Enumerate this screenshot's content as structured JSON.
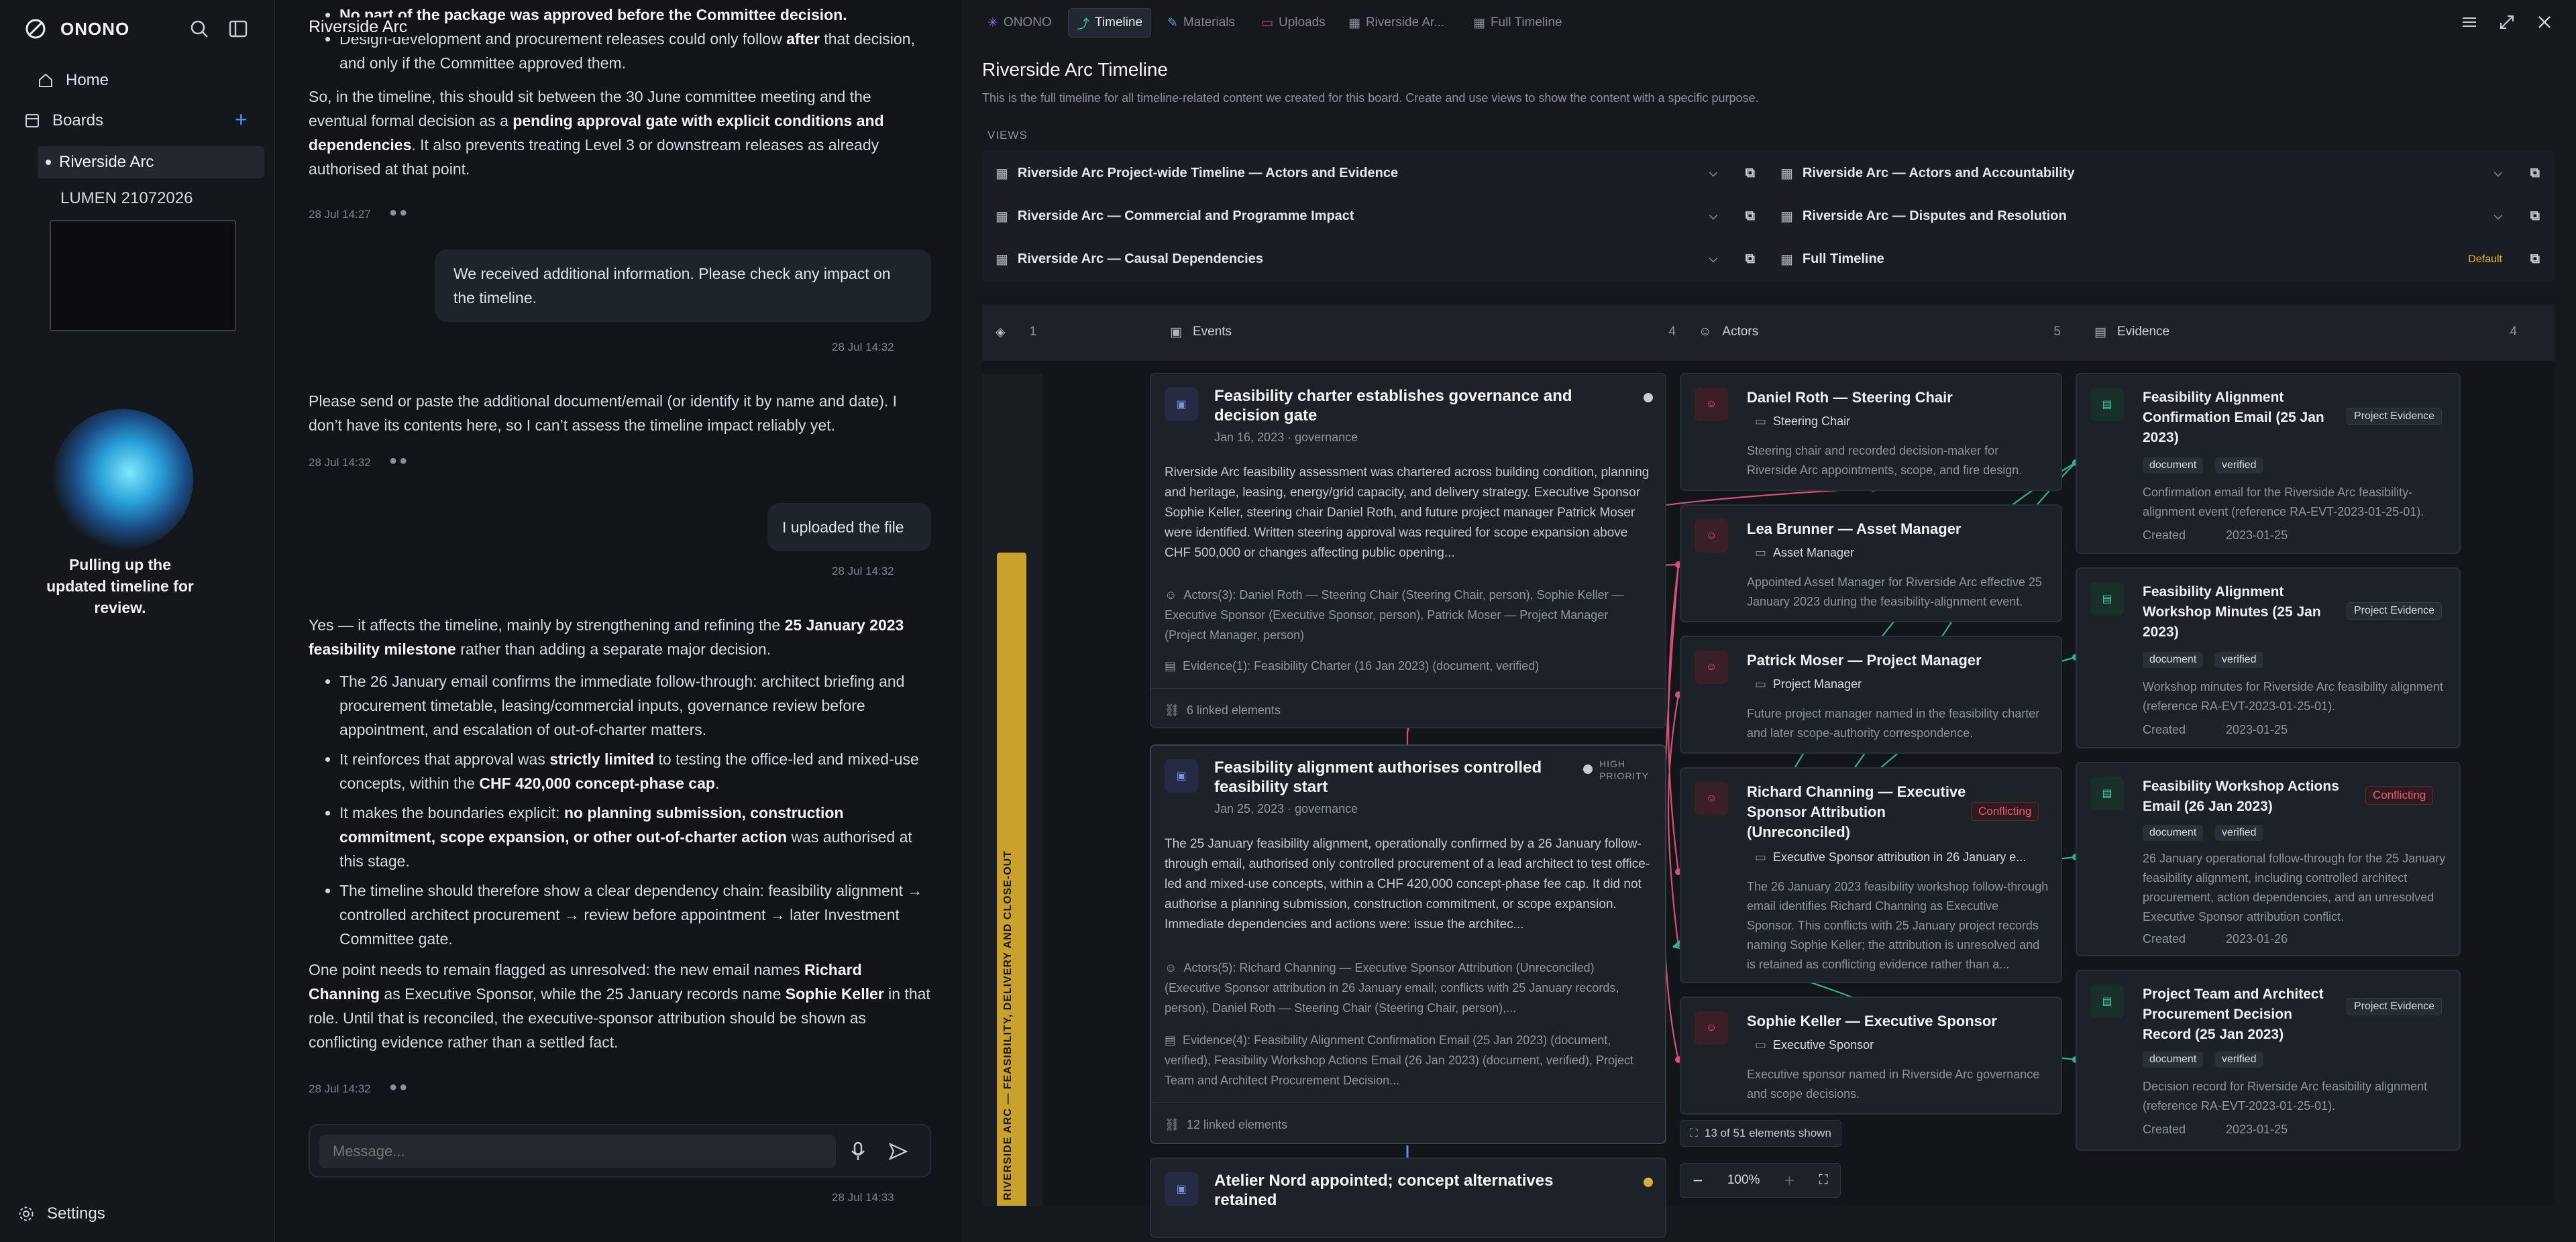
{
  "sidebar": {
    "brand": "ONONO",
    "home": "Home",
    "boards": "Boards",
    "board_items": [
      "Riverside Arc",
      "LUMEN 21072026"
    ],
    "status_text": "Pulling up the updated timeline for review.",
    "settings": "Settings"
  },
  "chat": {
    "title": "Riverside Arc",
    "m1_b1a": "No part of the package was approved before the Committee decision.",
    "m1_b2a": "Design-development and procurement releases could only follow ",
    "m1_b2b": "after",
    "m1_b2c": " that decision, and only if the Committee approved them.",
    "m1_p_a": "So, in the timeline, this should sit between the 30 June committee meeting and the eventual formal decision as a ",
    "m1_p_b": "pending approval gate with explicit conditions and dependencies",
    "m1_p_c": ". It also prevents treating Level 3 or downstream releases as already authorised at that point.",
    "ts1": "28 Jul 14:27",
    "u1": "We received additional information. Please check any impact on the timeline.",
    "ts2": "28 Jul 14:32",
    "m2": "Please send or paste the additional document/email (or identify it by name and date). I don’t have its contents here, so I can’t assess the timeline impact reliably yet.",
    "ts3": "28 Jul 14:32",
    "u2": "I uploaded the file",
    "ts4": "28 Jul 14:32",
    "m3_p_a": "Yes — it affects the timeline, mainly by strengthening and refining the ",
    "m3_p_b": "25 January 2023 feasibility milestone",
    "m3_p_c": " rather than adding a separate major decision.",
    "m3_l1": "The 26 January email confirms the immediate follow-through: architect briefing and procurement timetable, leasing/commercial inputs, governance review before appointment, and escalation of out-of-charter matters.",
    "m3_l2_a": "It reinforces that approval was ",
    "m3_l2_b": "strictly limited",
    "m3_l2_c": " to testing the office-led and mixed-use concepts, within the ",
    "m3_l2_d": "CHF 420,000 concept-phase cap",
    "m3_l2_e": ".",
    "m3_l3_a": "It makes the boundaries explicit: ",
    "m3_l3_b": "no planning submission, construction commitment, scope expansion, or other out-of-charter action",
    "m3_l3_c": " was authorised at this stage.",
    "m3_l4": "The timeline should therefore show a clear dependency chain: feasibility alignment → controlled architect procurement → review before appointment → later Investment Committee gate.",
    "m3_p2_a": "One point needs to remain flagged as unresolved: the new email names ",
    "m3_p2_b": "Richard Channing",
    "m3_p2_c": " as Executive Sponsor, while the 25 January records name ",
    "m3_p2_d": "Sophie Keller",
    "m3_p2_e": " in that role. Until that is reconciled, the executive-sponsor attribution should be shown as conflicting evidence rather than a settled fact.",
    "ts5": "28 Jul 14:32",
    "placeholder": "Message...",
    "ts6": "28 Jul 14:33"
  },
  "tabs": [
    "ONONO",
    "Timeline",
    "Materials",
    "Uploads",
    "Riverside Ar...",
    "Full Timeline"
  ],
  "timeline": {
    "title": "Riverside Arc Timeline",
    "description": "This is the full timeline for all timeline-related content we created for this board. Create and use views to show the content with a specific purpose.",
    "views_label": "VIEWS",
    "views": [
      "Riverside Arc Project-wide Timeline — Actors and Evidence",
      "Riverside Arc — Actors and Accountability",
      "Riverside Arc — Commercial and Programme Impact",
      "Riverside Arc — Disputes and Resolution",
      "Riverside Arc — Causal Dependencies",
      "Full Timeline"
    ],
    "default_label": "Default",
    "phase_count": "1",
    "columns": [
      {
        "name": "Events",
        "count": "4"
      },
      {
        "name": "Actors",
        "count": "5"
      },
      {
        "name": "Evidence",
        "count": "4"
      }
    ],
    "phase_label": "RIVERSIDE ARC — FEASIBILITY, DELIVERY AND CLOSE-OUT",
    "events": [
      {
        "title": "Feasibility charter establishes governance and decision gate",
        "date": "Jan 16, 2023 · governance",
        "body": "Riverside Arc feasibility assessment was chartered across building condition, planning and heritage, leasing, energy/grid capacity, and delivery strategy. Executive Sponsor Sophie Keller, steering chair Daniel Roth, and future project manager Patrick Moser were identified. Written steering approval was required for scope expansion above CHF 500,000 or changes affecting public opening...",
        "actors": "Actors(3): Daniel Roth — Steering Chair (Steering Chair, person), Sophie Keller — Executive Sponsor (Executive Sponsor, person), Patrick Moser — Project Manager (Project Manager, person)",
        "evidence": "Evidence(1): Feasibility Charter (16 Jan 2023) (document, verified)",
        "linked": "6 linked elements"
      },
      {
        "title": "Feasibility alignment authorises controlled feasibility start",
        "date": "Jan 25, 2023 · governance",
        "priority": "HIGH PRIORITY",
        "body": "The 25 January feasibility alignment, operationally confirmed by a 26 January follow-through email, authorised only controlled procurement of a lead architect to test office-led and mixed-use concepts, within a CHF 420,000 concept-phase fee cap. It did not authorise a planning submission, construction commitment, or scope expansion. Immediate dependencies and actions were: issue the architec...",
        "actors": "Actors(5): Richard Channing — Executive Sponsor Attribution (Unreconciled) (Executive Sponsor attribution in 26 January email; conflicts with 25 January records, person), Daniel Roth — Steering Chair (Steering Chair, person),...",
        "evidence": "Evidence(4): Feasibility Alignment Confirmation Email (25 Jan 2023) (document, verified), Feasibility Workshop Actions Email (26 Jan 2023) (document, verified), Project Team and Architect Procurement Decision...",
        "linked": "12 linked elements"
      },
      {
        "title": "Atelier Nord appointed; concept alternatives retained"
      }
    ],
    "actors": [
      {
        "name": "Daniel Roth — Steering Chair",
        "role": "Steering Chair",
        "desc": "Steering chair and recorded decision-maker for Riverside Arc appointments, scope, and fire design."
      },
      {
        "name": "Lea Brunner — Asset Manager",
        "role": "Asset Manager",
        "desc": "Appointed Asset Manager for Riverside Arc effective 25 January 2023 during the feasibility-alignment event."
      },
      {
        "name": "Patrick Moser — Project Manager",
        "role": "Project Manager",
        "desc": "Future project manager named in the feasibility charter and later scope-authority correspondence."
      },
      {
        "name": "Richard Channing — Executive Sponsor Attribution (Unreconciled)",
        "role": "Executive Sponsor attribution in 26 January e...",
        "conflict": "Conflicting",
        "desc": "The 26 January 2023 feasibility workshop follow-through email identifies Richard Channing as Executive Sponsor. This conflicts with 25 January project records naming Sophie Keller; the attribution is unresolved and is retained as conflicting evidence rather than a..."
      },
      {
        "name": "Sophie Keller — Executive Sponsor",
        "role": "Executive Sponsor",
        "desc": "Executive sponsor named in Riverside Arc governance and scope decisions."
      }
    ],
    "evidence": [
      {
        "name": "Feasibility Alignment Confirmation Email (25 Jan 2023)",
        "tag": "Project Evidence",
        "kind": "document",
        "status": "verified",
        "desc": "Confirmation email for the Riverside Arc feasibility-alignment event (reference RA-EVT-2023-01-25-01).",
        "created_label": "Created",
        "created": "2023-01-25"
      },
      {
        "name": "Feasibility Alignment Workshop Minutes (25 Jan 2023)",
        "tag": "Project Evidence",
        "kind": "document",
        "status": "verified",
        "desc": "Workshop minutes for Riverside Arc feasibility alignment (reference RA-EVT-2023-01-25-01).",
        "created_label": "Created",
        "created": "2023-01-25"
      },
      {
        "name": "Feasibility Workshop Actions Email (26 Jan 2023)",
        "tag": "Conflicting",
        "kind": "document",
        "status": "verified",
        "desc": "26 January operational follow-through for the 25 January feasibility alignment, including controlled architect procurement, action dependencies, and an unresolved Executive Sponsor attribution conflict.",
        "created_label": "Created",
        "created": "2023-01-26"
      },
      {
        "name": "Project Team and Architect Procurement Decision Record (25 Jan 2023)",
        "tag": "Project Evidence",
        "kind": "document",
        "status": "verified",
        "desc": "Decision record for Riverside Arc feasibility alignment (reference RA-EVT-2023-01-25-01).",
        "created_label": "Created",
        "created": "2023-01-25"
      }
    ],
    "shown": "13 of 51 elements shown",
    "zoom": "100%"
  },
  "colors": {
    "accent_yellow": "#c9a22d",
    "actor_pink": "#d6507a",
    "evidence_teal": "#2fb391",
    "conflict_red": "#ef5a73"
  }
}
